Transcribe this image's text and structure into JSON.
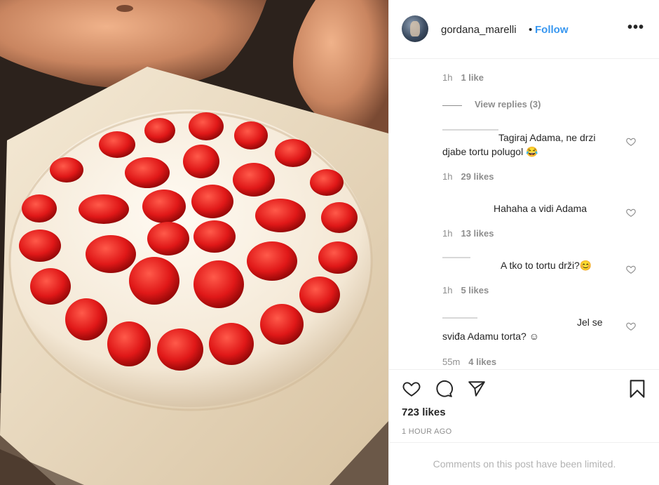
{
  "post": {
    "username": "gordana_marelli",
    "separator": "•",
    "follow_label": "Follow",
    "more_label": "•••"
  },
  "comments": {
    "top_meta": {
      "time": "1h",
      "likes": "1 like"
    },
    "view_replies": "View replies (3)",
    "items": [
      {
        "text_line1": "Tagiraj Adama, ne drzi",
        "text_line2": "djabe tortu polugol 😂",
        "time": "1h",
        "likes": "29 likes"
      },
      {
        "text_line1": "Hahaha a vidi Adama",
        "time": "1h",
        "likes": "13 likes"
      },
      {
        "text_line1": "A tko to tortu drži?😊",
        "time": "1h",
        "likes": "5 likes"
      },
      {
        "text_line1": "Jel se",
        "text_line2": "sviđa Adamu torta? ☺",
        "time": "55m",
        "likes": "4 likes"
      }
    ]
  },
  "actions": {
    "likes_total": "723 likes",
    "time_ago": "1 HOUR AGO",
    "icons": [
      "heart-icon",
      "comment-icon",
      "share-icon",
      "bookmark-icon"
    ]
  },
  "footer": {
    "limited_text": "Comments on this post have been limited."
  },
  "colors": {
    "accent": "#3897f0",
    "muted": "#8e8e8e",
    "text": "#262626"
  }
}
